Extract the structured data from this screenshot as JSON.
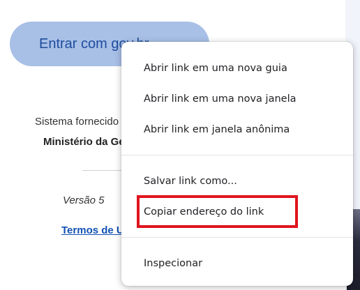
{
  "page": {
    "login_button_label": "Entrar com gov.br",
    "provider_text": "Sistema fornecido pelo",
    "ministry_text": "Ministério da Gestão",
    "version_text": "Versão 5",
    "terms_link_text": "Termos de Uso"
  },
  "context_menu": {
    "items": [
      {
        "label": "Abrir link em uma nova guia"
      },
      {
        "label": "Abrir link em uma nova janela"
      },
      {
        "label": "Abrir link em janela anônima"
      },
      {
        "label": "Salvar link como..."
      },
      {
        "label": "Copiar endereço do link"
      },
      {
        "label": "Inspecionar"
      }
    ]
  },
  "annotation": {
    "highlight_color": "#e0141e"
  }
}
